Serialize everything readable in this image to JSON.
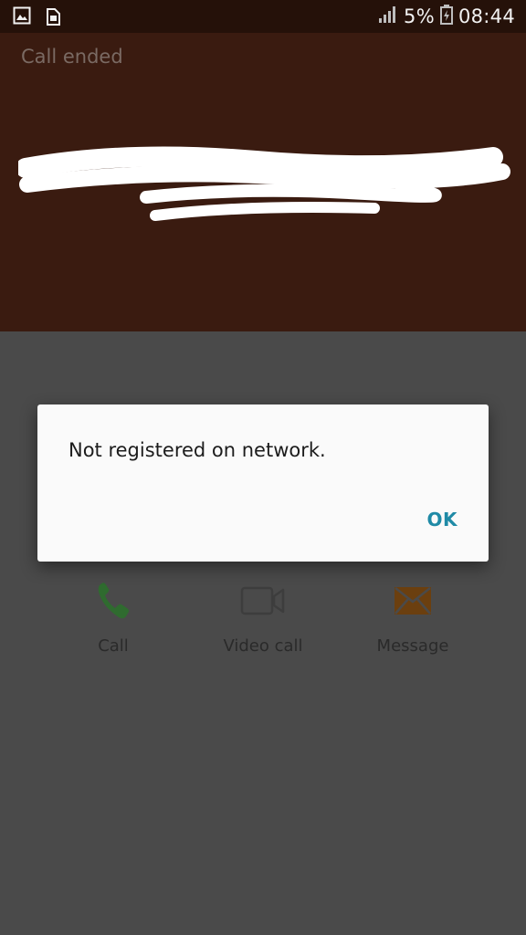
{
  "status_bar": {
    "battery_percent": "5%",
    "time": "08:44"
  },
  "call_header": {
    "status": "Call ended"
  },
  "actions": [
    {
      "label": "Call",
      "icon": "phone-icon",
      "color": "#2f6b2f"
    },
    {
      "label": "Video call",
      "icon": "video-camera-icon",
      "color": "#3d3d3d"
    },
    {
      "label": "Message",
      "icon": "envelope-icon",
      "color": "#6b3f0f"
    }
  ],
  "dialog": {
    "message": "Not registered on network.",
    "ok_label": "OK"
  },
  "colors": {
    "status_bar_bg": "#251109",
    "header_bg": "#3a1b10",
    "dim_bg": "#4a4a4a",
    "accent": "#1f8aa6"
  }
}
